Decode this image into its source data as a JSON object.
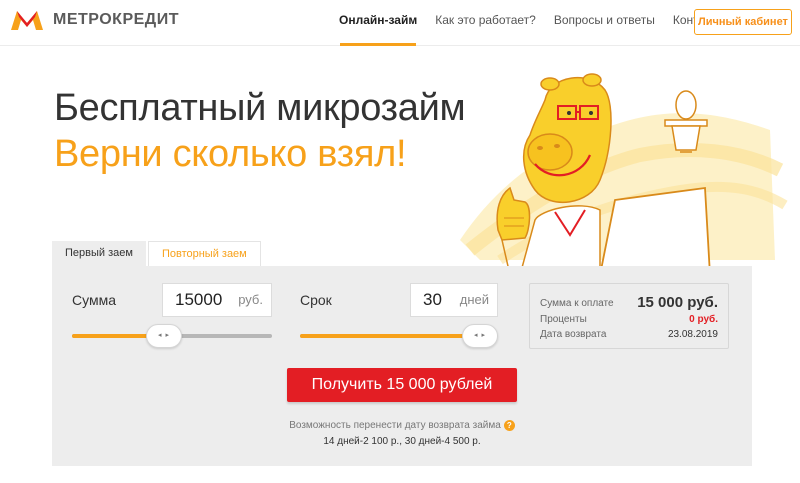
{
  "header": {
    "logo_text": "МЕТРОКРЕДИТ",
    "nav": [
      {
        "label": "Онлайн-займ",
        "active": true
      },
      {
        "label": "Как это работает?",
        "active": false
      },
      {
        "label": "Вопросы и ответы",
        "active": false
      },
      {
        "label": "Контакты",
        "active": false
      }
    ],
    "cabinet_label": "Личный кабинет"
  },
  "hero": {
    "title": "Бесплатный микрозайм",
    "subtitle": "Верни сколько взял!"
  },
  "tabs": [
    {
      "label": "Первый заем",
      "active": true
    },
    {
      "label": "Повторный заем",
      "active": false
    }
  ],
  "calculator": {
    "amount": {
      "label": "Сумма",
      "value": "15000",
      "unit": "руб.",
      "slider_fraction": 0.45
    },
    "term": {
      "label": "Срок",
      "value": "30",
      "unit": "дней",
      "slider_fraction": 1.0
    },
    "slider_handle_glyph": "◂ ▸",
    "summary": {
      "total_label": "Сумма к оплате",
      "total_value": "15 000 руб.",
      "interest_label": "Проценты",
      "interest_value": "0 руб.",
      "date_label": "Дата возврата",
      "date_value": "23.08.2019"
    },
    "cta_label": "Получить 15 000 рублей",
    "postpone_text": "Возможность перенести дату возврата займа",
    "postpone_help": "?",
    "postpone_prices": "14 дней-2 100 р., 30 дней-4 500 р."
  },
  "colors": {
    "accent_orange": "#f7a11a",
    "cta_red": "#e31e24",
    "panel_bg": "#ededed"
  }
}
